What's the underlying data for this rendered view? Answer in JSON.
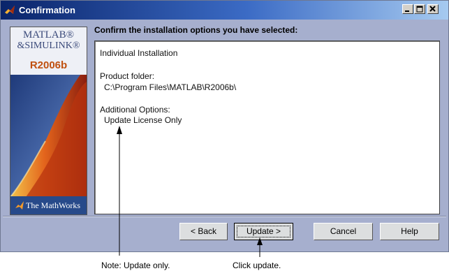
{
  "window": {
    "title": "Confirmation",
    "title_icon": "matlab-membrane-icon",
    "controls": [
      "minimize-icon",
      "maximize-icon",
      "close-icon"
    ]
  },
  "sidepanel": {
    "logo_line1": "MATLAB®",
    "logo_line2": "&SIMULINK®",
    "release": "R2006b",
    "footer": "The MathWorks",
    "colors": {
      "accent": "#c0500f",
      "footer_bg": "#274a8a"
    }
  },
  "heading": "Confirm the installation options you have selected:",
  "summary": {
    "installation_type": "Individual Installation",
    "product_folder_label": "Product folder:",
    "product_folder_value": "C:\\Program Files\\MATLAB\\R2006b\\",
    "options_label": "Additional Options:",
    "options_value": "Update License Only"
  },
  "buttons": {
    "back": "< Back",
    "update": "Update >",
    "cancel": "Cancel",
    "help": "Help"
  },
  "annotations": {
    "note": "Note: Update only.",
    "click": "Click update."
  }
}
